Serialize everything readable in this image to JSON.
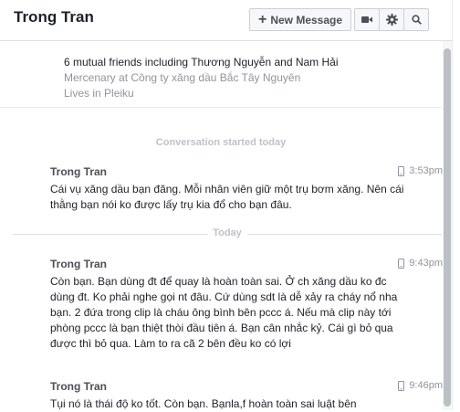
{
  "header": {
    "title": "Trong Tran",
    "new_message_label": "New Message"
  },
  "profile": {
    "mutual": "6 mutual friends including Thương Nguyễn and Nam Hải",
    "work": "Mercenary at Công ty xăng dầu Bắc Tây Nguyên",
    "lives": "Lives in Pleiku"
  },
  "conversation": {
    "started_label": "Conversation started today",
    "day_label": "Today",
    "messages": [
      {
        "sender": "Trong Tran",
        "time": "3:53pm",
        "text": "Cái vụ xăng dầu bạn đăng. Mỗi nhân viên giữ một trụ bơm xăng. Nên cái thằng bạn nói ko được lấy trụ kia đổ cho bạn đâu."
      },
      {
        "sender": "Trong Tran",
        "time": "9:43pm",
        "text": "Còn bạn. Bạn dùng đt để quay là hoàn toàn sai. Ở ch xăng dầu ko đc dùng đt. Ko phải nghe gọi nt đâu. Cứ dùng sdt là dễ xảy ra cháy nổ nha bạn. 2 đứa trong clip là cháu ông bình bên pccc á. Nếu mà clip này tới phòng pccc là bạn thiệt thòi đầu tiên á. Bạn cân nhắc kỷ. Cái gì bỏ qua được thì bỏ qua. Làm to ra cã 2 bên đều ko có lợi"
      },
      {
        "sender": "Trong Tran",
        "time": "9:46pm",
        "text": "Tụi nó là thái độ ko tốt. Còn bạn. Bạnla,f hoàn toàn sai luật bên"
      }
    ]
  },
  "icons": {
    "plus": "plus-icon",
    "video": "video-camera-icon",
    "settings": "gear-icon",
    "search": "search-icon",
    "phone": "mobile-phone-icon"
  },
  "colors": {
    "sender": "#4b4f56",
    "muted": "#90949c",
    "border": "#dddfe2"
  }
}
